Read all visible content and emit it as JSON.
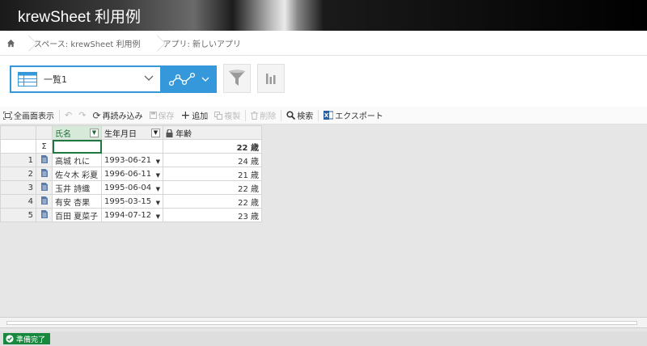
{
  "app": {
    "title": "krewSheet 利用例"
  },
  "breadcrumb": {
    "items": [
      {
        "label": "スペース: krewSheet 利用例"
      },
      {
        "label": "アプリ: 新しいアプリ"
      }
    ]
  },
  "viewbar": {
    "view_name": "一覧1"
  },
  "toolbar": {
    "fullscreen": "全画面表示",
    "reload": "再読み込み",
    "save": "保存",
    "add": "追加",
    "copy": "複製",
    "delete": "削除",
    "search": "検索",
    "export": "エクスポート"
  },
  "grid": {
    "columns": [
      "氏名",
      "生年月日",
      "年齢"
    ],
    "sum_symbol": "Σ",
    "sum_age": "22 歳",
    "rows": [
      {
        "num": "1",
        "name": "高城 れに",
        "birth": "1993-06-21",
        "age": "24 歳"
      },
      {
        "num": "2",
        "name": "佐々木 彩夏",
        "birth": "1996-06-11",
        "age": "21 歳"
      },
      {
        "num": "3",
        "name": "玉井 詩織",
        "birth": "1995-06-04",
        "age": "22 歳"
      },
      {
        "num": "4",
        "name": "有安 杏果",
        "birth": "1995-03-15",
        "age": "22 歳"
      },
      {
        "num": "5",
        "name": "百田 夏菜子",
        "birth": "1994-07-12",
        "age": "23 歳"
      }
    ]
  },
  "status": {
    "label": "準備完了"
  },
  "colors": {
    "accent": "#3498db",
    "status": "#18883f",
    "selection": "#1d7a3e"
  }
}
